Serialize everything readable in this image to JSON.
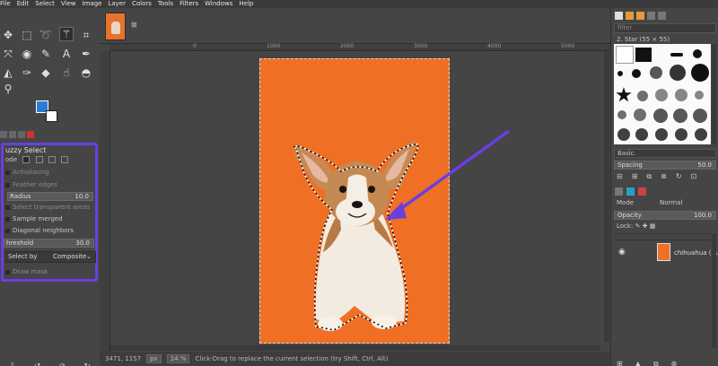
{
  "menu": [
    "File",
    "Edit",
    "Select",
    "View",
    "Image",
    "Layer",
    "Colors",
    "Tools",
    "Filters",
    "Windows",
    "Help"
  ],
  "colors": {
    "accent": "#6a3fe0",
    "image_bg": "#ef6f24",
    "foreground": "#2b7bd6",
    "background": "#ffffff"
  },
  "toolbox": {
    "tools": [
      "move-icon",
      "rect-select-icon",
      "lasso-icon",
      "fuzzy-select-icon",
      "crop-icon",
      "transform-icon",
      "warp-icon",
      "path-icon",
      "text-icon",
      "bucket-fill-icon",
      "paintbrush-icon",
      "eraser-icon",
      "clone-icon",
      "smudge-icon",
      "dodge-icon",
      "color-picker-icon",
      "zoom-icon"
    ]
  },
  "fuzzy": {
    "title": "uzzy Select",
    "mode_label": "ode",
    "antialiasing": "Antialiasing",
    "feather": "Feather edges",
    "radius_label": "Radius",
    "radius_value": "10.0",
    "transparent": "Select transparent areas",
    "sample_merged": "Sample merged",
    "diagonal": "Diagonal neighbors",
    "threshold_label": "hreshold",
    "threshold_value": "30.0",
    "select_by_label": "Select by",
    "select_by_value": "Composite",
    "draw_mask": "Draw mask"
  },
  "ruler": [
    "0",
    "1000",
    "2000",
    "3000",
    "4000",
    "5000"
  ],
  "status": {
    "coords": "3471, 1157",
    "unit": "px",
    "zoom": "14 %",
    "message": "Click-Drag to replace the current selection (try Shift, Ctrl, Alt)"
  },
  "brushes": {
    "filter_placeholder": "filter",
    "name": "2. Star (55 × 55)",
    "preset": "Basic.",
    "spacing_label": "Spacing",
    "spacing_value": "50.0"
  },
  "layers": {
    "mode_label": "Mode",
    "mode_value": "Normal",
    "opacity_label": "Opacity",
    "opacity_value": "100.0",
    "lock_label": "Lock:",
    "layer_name": "chihuahua (pupp"
  }
}
